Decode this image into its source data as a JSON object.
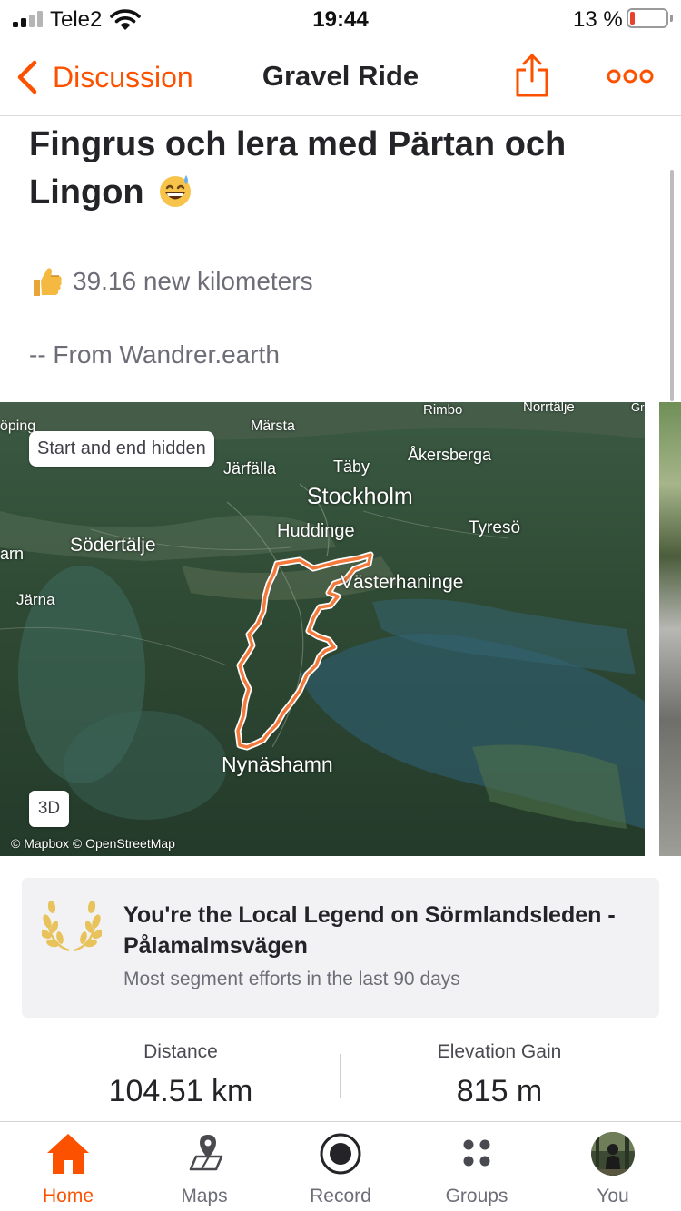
{
  "status_bar": {
    "carrier": "Tele2",
    "time": "19:44",
    "battery_percent": "13 %",
    "battery_level": 0.13,
    "signal_bars_filled": 2,
    "signal_bars_total": 4
  },
  "nav": {
    "back_label": "Discussion",
    "title": "Gravel Ride",
    "icons": [
      "chevron-left-icon",
      "share-icon",
      "more-icon"
    ],
    "accent_color": "#fc5200"
  },
  "post": {
    "title": "Fingrus och lera med Pärtan och Lingon",
    "title_emoji": "grinning-sweat-emoji",
    "new_kilometers": "39.16 new kilometers",
    "source": "-- From Wandrer.earth"
  },
  "map": {
    "start_end_hidden": "Start and end hidden",
    "mode_button": "3D",
    "attribution": "© Mapbox © OpenStreetMap",
    "route_color": "#f37a3c",
    "places": [
      "Rimbo",
      "Norrtälje",
      "Gr",
      "öping",
      "Märsta",
      "Järfälla",
      "Täby",
      "Åkersberga",
      "Stockholm",
      "Huddinge",
      "Tyresö",
      "arn",
      "Södertälje",
      "Västerhaninge",
      "Järna",
      "Nynäshamn"
    ]
  },
  "local_legend": {
    "title": "You're the Local Legend on Sörmlandsleden - Pålamalmsvägen",
    "subtitle": "Most segment efforts in the last 90 days",
    "icon": "laurel-wreath-icon",
    "icon_color": "#e8c25a"
  },
  "stats": {
    "distance_label": "Distance",
    "distance_value": "104.51 km",
    "elevation_label": "Elevation Gain",
    "elevation_value": "815 m"
  },
  "tabs": [
    {
      "label": "Home",
      "icon": "home-icon",
      "active": true
    },
    {
      "label": "Maps",
      "icon": "map-icon",
      "active": false
    },
    {
      "label": "Record",
      "icon": "record-icon",
      "active": false
    },
    {
      "label": "Groups",
      "icon": "groups-icon",
      "active": false
    },
    {
      "label": "You",
      "icon": "avatar",
      "active": false
    }
  ]
}
